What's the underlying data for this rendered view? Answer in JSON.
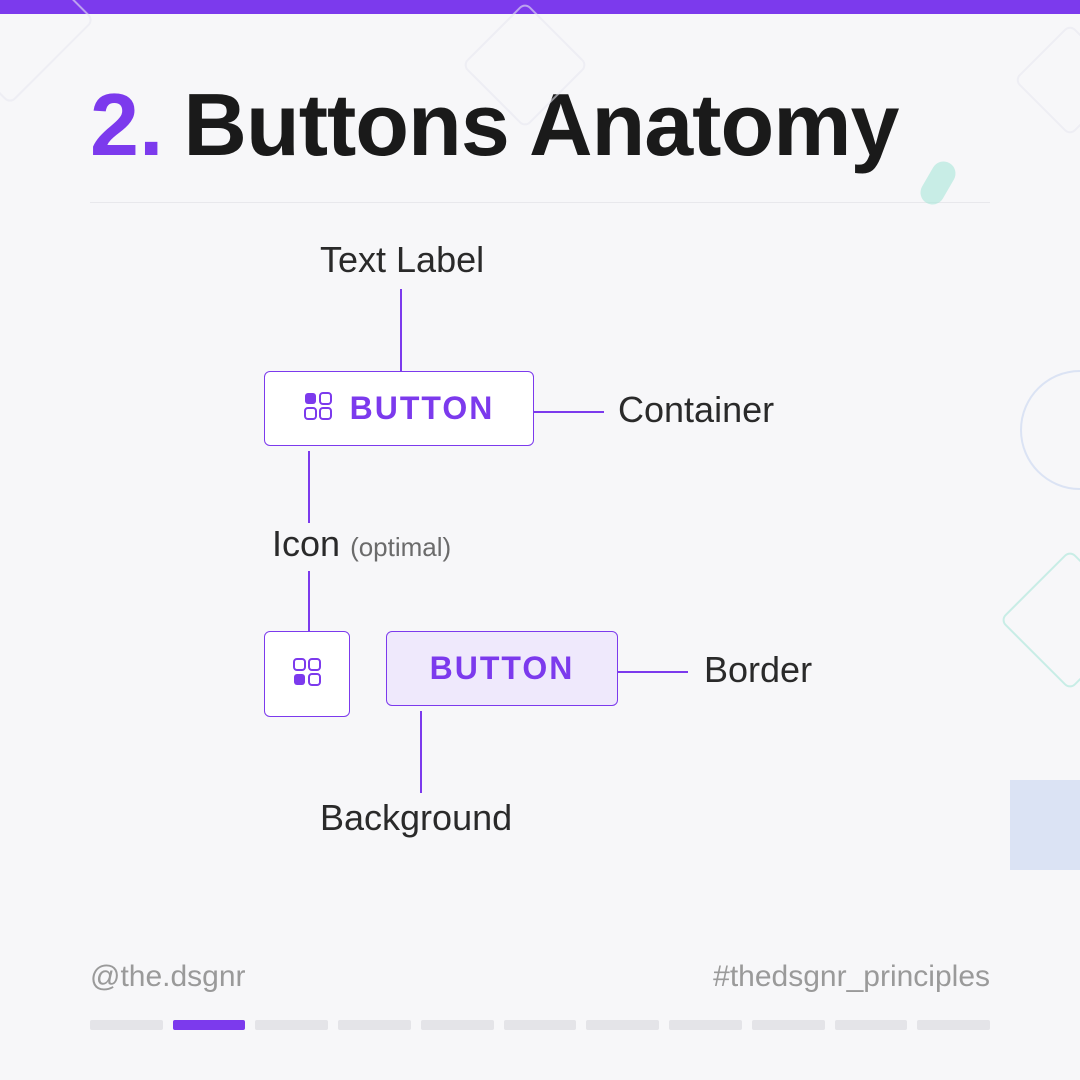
{
  "header": {
    "number": "2.",
    "title": "Buttons Anatomy"
  },
  "labels": {
    "text_label": "Text Label",
    "container": "Container",
    "icon": "Icon",
    "icon_sub": "(optimal)",
    "border": "Border",
    "background": "Background"
  },
  "buttons": {
    "primary_label": "BUTTON",
    "secondary_label": "BUTTON"
  },
  "footer": {
    "handle": "@the.dsgnr",
    "hashtag": "#thedsgnr_principles"
  },
  "progress": {
    "total": 11,
    "active_index": 1
  },
  "colors": {
    "accent": "#7c3aed",
    "fill": "#efe9fc"
  }
}
